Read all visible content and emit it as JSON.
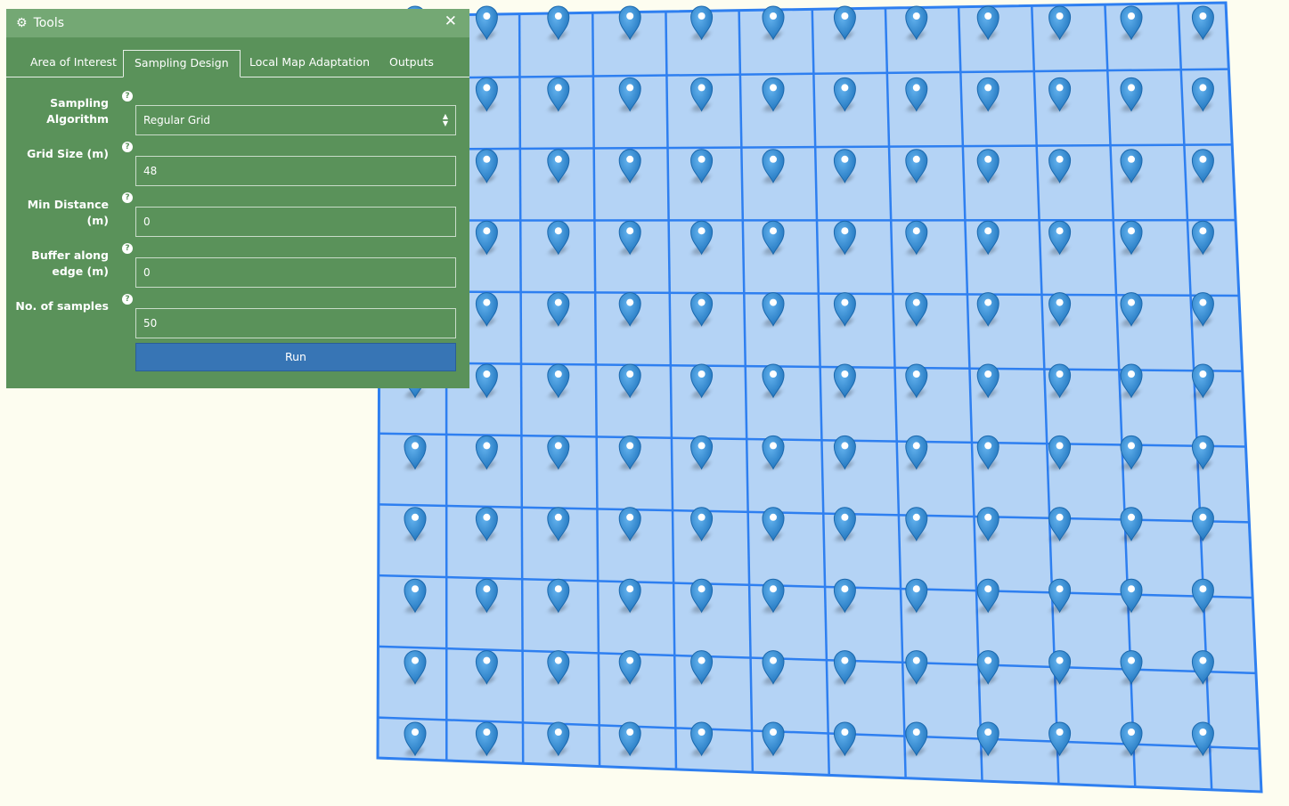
{
  "panel": {
    "title": "Tools",
    "close_symbol": "✕",
    "gear_symbol": "⚙",
    "tabs": [
      {
        "label": "Area of Interest",
        "active": false
      },
      {
        "label": "Sampling Design",
        "active": true
      },
      {
        "label": "Local Map Adaptation",
        "active": false
      },
      {
        "label": "Outputs",
        "active": false
      }
    ],
    "form": {
      "algorithm": {
        "label_line1": "Sampling",
        "label_line2": "Algorithm",
        "value": "Regular Grid"
      },
      "grid_size": {
        "label": "Grid Size (m)",
        "value": "48"
      },
      "min_distance": {
        "label_line1": "Min Distance",
        "label_line2": "(m)",
        "value": "0"
      },
      "buffer": {
        "label_line1": "Buffer along",
        "label_line2": "edge (m)",
        "value": "0"
      },
      "samples": {
        "label": "No. of samples",
        "value": "50"
      },
      "help_symbol": "?",
      "run_label": "Run"
    }
  },
  "map": {
    "grid_columns": 12,
    "grid_rows": 11,
    "cell_fill": "#b4d3f5",
    "line_color": "#2e7ff0",
    "marker_color": "#2a84d0",
    "background": "#fdfdf0",
    "marker_icon": "map-pin-icon"
  }
}
